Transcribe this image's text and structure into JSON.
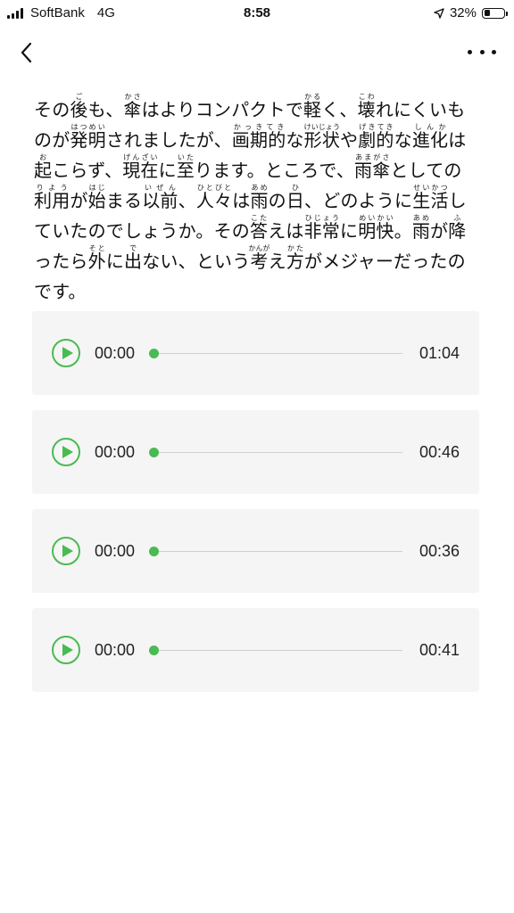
{
  "status_bar": {
    "carrier": "SoftBank",
    "network": "4G",
    "time": "8:58",
    "battery_percent": "32%",
    "battery_level": 0.32
  },
  "nav": {
    "back_icon": "chevron-left-icon",
    "more_icon": "more-horizontal-icon"
  },
  "article": {
    "segments": [
      [
        "その",
        ""
      ],
      [
        "後",
        "ご"
      ],
      [
        "も、",
        ""
      ],
      [
        "傘",
        "かさ"
      ],
      [
        "はよりコンパクトで",
        ""
      ],
      [
        "軽",
        "かる"
      ],
      [
        "く、",
        ""
      ],
      [
        "壊",
        "こわ"
      ],
      [
        "れにくいものが",
        ""
      ],
      [
        "発明",
        "はつめい"
      ],
      [
        "されましたが、",
        ""
      ],
      [
        "画期的",
        "かっきてき"
      ],
      [
        "な",
        ""
      ],
      [
        "形状",
        "けいじょう"
      ],
      [
        "や",
        ""
      ],
      [
        "劇的",
        "げきてき"
      ],
      [
        "な",
        ""
      ],
      [
        "進化",
        "しんか"
      ],
      [
        "は",
        ""
      ],
      [
        "起",
        "お"
      ],
      [
        "こらず、",
        ""
      ],
      [
        "現在",
        "げんざい"
      ],
      [
        "に",
        ""
      ],
      [
        "至",
        "いた"
      ],
      [
        "ります。ところで、",
        ""
      ],
      [
        "雨傘",
        "あまがさ"
      ],
      [
        "としての",
        ""
      ],
      [
        "利用",
        "りよう"
      ],
      [
        "が",
        ""
      ],
      [
        "始",
        "はじ"
      ],
      [
        "まる",
        ""
      ],
      [
        "以前",
        "いぜん"
      ],
      [
        "、",
        ""
      ],
      [
        "人々",
        "ひとびと"
      ],
      [
        "は",
        ""
      ],
      [
        "雨",
        "あめ"
      ],
      [
        "の",
        ""
      ],
      [
        "日",
        "ひ"
      ],
      [
        "、どのように",
        ""
      ],
      [
        "生活",
        "せいかつ"
      ],
      [
        "し",
        ""
      ],
      [
        "ていたのでしょうか。その",
        ""
      ],
      [
        "答",
        "こた"
      ],
      [
        "えは",
        ""
      ],
      [
        "非常",
        "ひじょう"
      ],
      [
        "に",
        ""
      ],
      [
        "明快",
        "めいかい"
      ],
      [
        "。",
        ""
      ],
      [
        "雨",
        "あめ"
      ],
      [
        "が",
        ""
      ],
      [
        "降",
        "ふ"
      ],
      [
        "ったら",
        ""
      ],
      [
        "外",
        "そと"
      ],
      [
        "に",
        ""
      ],
      [
        "出",
        "で"
      ],
      [
        "ない、という",
        ""
      ],
      [
        "考",
        "かんが"
      ],
      [
        "え",
        ""
      ],
      [
        "方",
        "かた"
      ],
      [
        "がメジャーだったのです。",
        ""
      ]
    ]
  },
  "players": [
    {
      "current": "00:00",
      "duration": "01:04",
      "progress": 0
    },
    {
      "current": "00:00",
      "duration": "00:46",
      "progress": 0
    },
    {
      "current": "00:00",
      "duration": "00:36",
      "progress": 0
    },
    {
      "current": "00:00",
      "duration": "00:41",
      "progress": 0
    }
  ],
  "colors": {
    "accent": "#4aba52",
    "player_bg": "#f5f5f5",
    "track": "#cfcfcf"
  }
}
